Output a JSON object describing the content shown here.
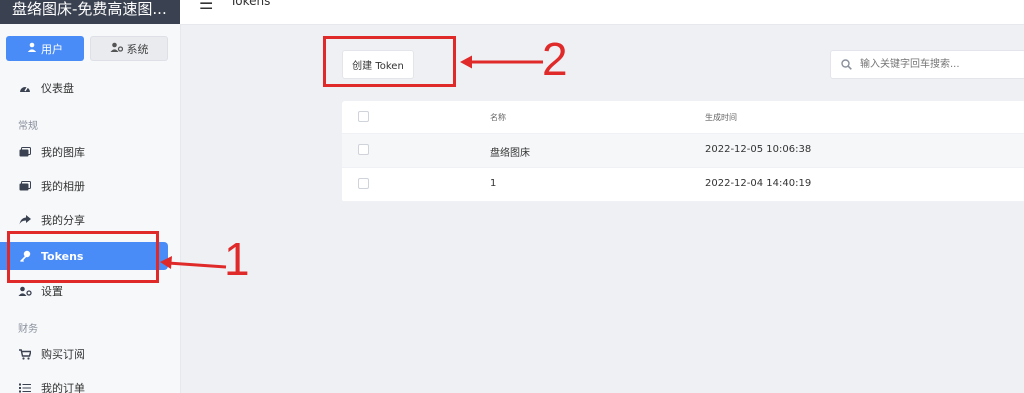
{
  "app": {
    "brand": "盘络图床-免费高速图..."
  },
  "sidebar": {
    "tabs": [
      {
        "label": "用户"
      },
      {
        "label": "系统"
      }
    ],
    "dashboard": "仪表盘",
    "groups": [
      "常规",
      "财务"
    ],
    "items": [
      {
        "label": "我的图库"
      },
      {
        "label": "我的相册"
      },
      {
        "label": "我的分享"
      },
      {
        "label": "Tokens"
      },
      {
        "label": "设置"
      },
      {
        "label": "购买订阅"
      },
      {
        "label": "我的订单"
      }
    ]
  },
  "header": {
    "title": "Tokens"
  },
  "toolbar": {
    "create_label": "创建 Token",
    "search_placeholder": "输入关键字回车搜索..."
  },
  "table": {
    "columns": [
      "名称",
      "生成时间"
    ],
    "rows": [
      {
        "name": "盘络图床",
        "created": "2022-12-05 10:06:38"
      },
      {
        "name": "1",
        "created": "2022-12-04 14:40:19"
      }
    ]
  },
  "annotations": {
    "one": "1",
    "two": "2"
  },
  "colors": {
    "accent": "#4a8cf7",
    "highlight": "#e02a2a",
    "topbar_dark": "#3a4150"
  }
}
